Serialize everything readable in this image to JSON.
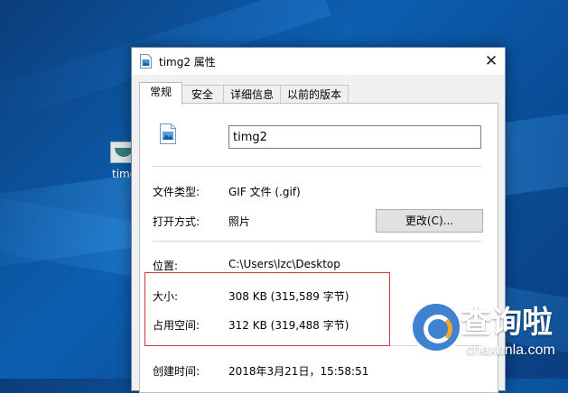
{
  "desktop": {
    "icon_label": "timg"
  },
  "window": {
    "title": "timg2 属性",
    "close_glyph": "✕"
  },
  "tabs": [
    {
      "label": "常规",
      "active": true
    },
    {
      "label": "安全",
      "active": false
    },
    {
      "label": "详细信息",
      "active": false
    },
    {
      "label": "以前的版本",
      "active": false
    }
  ],
  "general": {
    "file_name": "timg2",
    "type_label": "文件类型:",
    "type_value": "GIF 文件 (.gif)",
    "open_with_label": "打开方式:",
    "open_with_value": "照片",
    "change_button": "更改(C)...",
    "location_label": "位置:",
    "location_value": "C:\\Users\\lzc\\Desktop",
    "size_label": "大小:",
    "size_value": "308 KB (315,589 字节)",
    "disk_size_label": "占用空间:",
    "disk_size_value": "312 KB (319,488 字节)",
    "created_label": "创建时间:",
    "created_value": "2018年3月21日，15:58:51"
  },
  "watermark": {
    "title": "查询啦",
    "subtitle": "chaxunla.com"
  },
  "colors": {
    "highlight_box": "#c9393f",
    "watermark_blue": "#3e82d1"
  },
  "icons": [
    "image-file-icon",
    "close-icon",
    "desktop-image-icon",
    "search-logo-icon"
  ]
}
